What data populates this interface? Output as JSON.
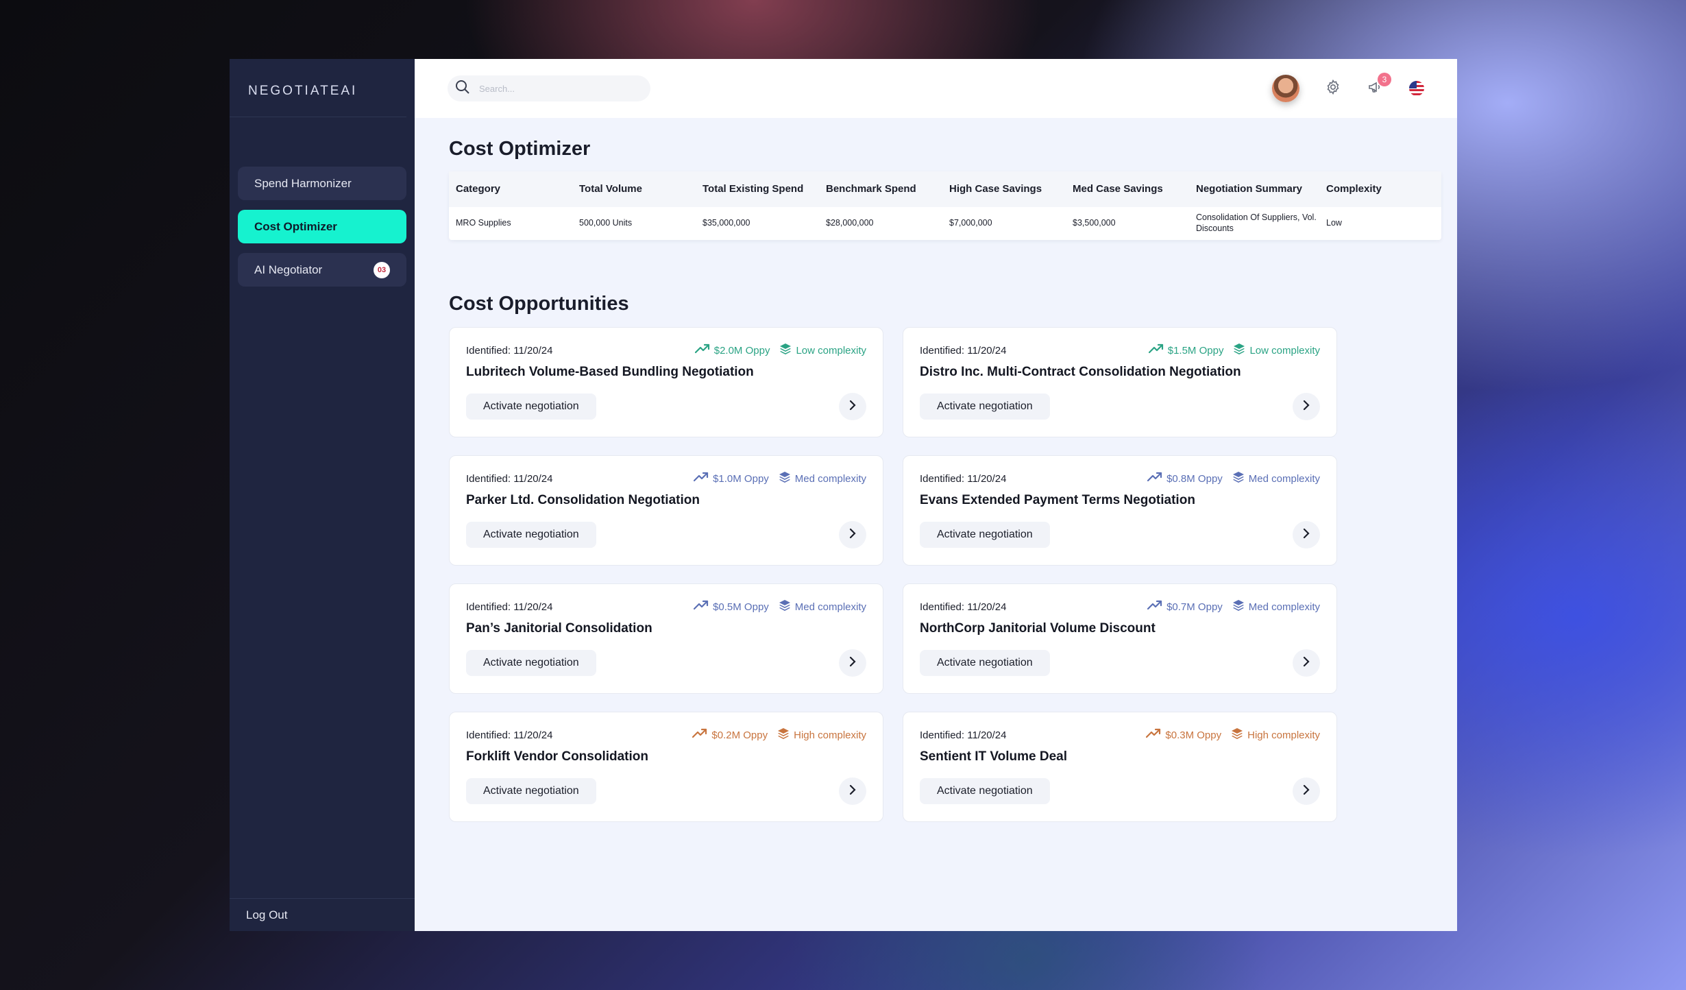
{
  "sidebar": {
    "brand": "NEGOTIATEAI",
    "items": [
      {
        "label": "Spend Harmonizer"
      },
      {
        "label": "Cost Optimizer"
      },
      {
        "label": "AI Negotiator",
        "badge": "03"
      }
    ],
    "logout_label": "Log Out"
  },
  "header": {
    "search_placeholder": "Search...",
    "notification_count": "3"
  },
  "cost_optimizer": {
    "title": "Cost Optimizer",
    "columns": [
      "Category",
      "Total Volume",
      "Total Existing Spend",
      "Benchmark Spend",
      "High Case Savings",
      "Med Case Savings",
      "Negotiation Summary",
      "Complexity"
    ],
    "rows": [
      [
        "MRO Supplies",
        "500,000 Units",
        "$35,000,000",
        "$28,000,000",
        "$7,000,000",
        "$3,500,000",
        "Consolidation Of Suppliers, Vol. Discounts",
        "Low"
      ]
    ]
  },
  "opportunities": {
    "title": "Cost Opportunities",
    "action_label": "Activate negotiation",
    "cards": [
      {
        "identified": "Identified: 11/20/24",
        "oppy": "$2.0M Oppy",
        "complexity": "Low complexity",
        "title": "Lubritech Volume-Based Bundling Negotiation"
      },
      {
        "identified": "Identified: 11/20/24",
        "oppy": "$1.5M Oppy",
        "complexity": "Low complexity",
        "title": "Distro Inc. Multi-Contract Consolidation Negotiation"
      },
      {
        "identified": "Identified: 11/20/24",
        "oppy": "$1.0M Oppy",
        "complexity": "Med complexity",
        "title": "Parker Ltd. Consolidation Negotiation"
      },
      {
        "identified": "Identified: 11/20/24",
        "oppy": "$0.8M Oppy",
        "complexity": "Med complexity",
        "title": "Evans Extended Payment Terms Negotiation"
      },
      {
        "identified": "Identified: 11/20/24",
        "oppy": "$0.5M Oppy",
        "complexity": "Med complexity",
        "title": "Pan’s Janitorial Consolidation"
      },
      {
        "identified": "Identified: 11/20/24",
        "oppy": "$0.7M Oppy",
        "complexity": "Med complexity",
        "title": "NorthCorp Janitorial Volume Discount"
      },
      {
        "identified": "Identified: 11/20/24",
        "oppy": "$0.2M Oppy",
        "complexity": "High complexity",
        "title": "Forklift Vendor Consolidation"
      },
      {
        "identified": "Identified: 11/20/24",
        "oppy": "$0.3M Oppy",
        "complexity": "High complexity",
        "title": "Sentient IT Volume Deal"
      }
    ]
  },
  "colors": {
    "accent": "#16f2cf",
    "sidebar_bg": "#1f2540",
    "low_complexity": "#2aa384",
    "med_complexity": "#5a6fb5",
    "high_complexity": "#c8743e",
    "oppy_low": "#2aa384",
    "oppy_med": "#5a6fb5",
    "oppy_high": "#c8743e"
  }
}
